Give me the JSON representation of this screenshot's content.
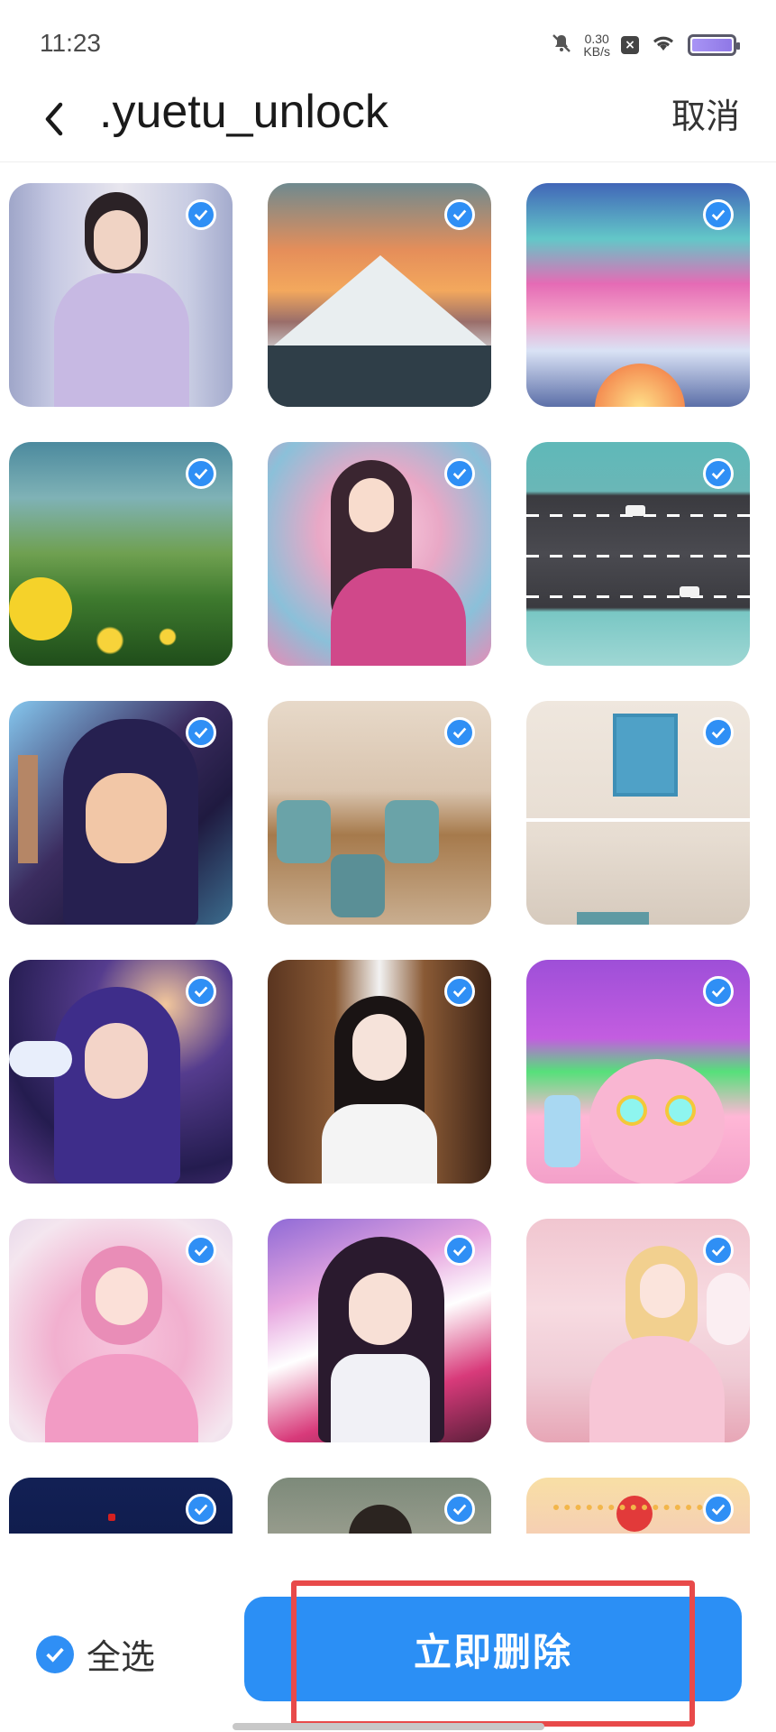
{
  "status_bar": {
    "time": "11:23",
    "net_speed_value": "0.30",
    "net_speed_unit": "KB/s",
    "icons": [
      "mute-icon",
      "close-box-icon",
      "wifi-icon",
      "battery-icon"
    ]
  },
  "header": {
    "back_icon": "chevron-left-icon",
    "title": ".yuetu_unlock",
    "cancel_label": "取消"
  },
  "grid": {
    "tiles": [
      {
        "scene": "woman-lavender-dress",
        "selected": true
      },
      {
        "scene": "snowy-mountain-sunset",
        "selected": true
      },
      {
        "scene": "aurora-over-mountains",
        "selected": true
      },
      {
        "scene": "alpine-meadow-flowers",
        "selected": true
      },
      {
        "scene": "anime-fairy-pink-dress",
        "selected": true
      },
      {
        "scene": "aerial-highway",
        "selected": true
      },
      {
        "scene": "anime-cat-ear-girl-castle",
        "selected": true
      },
      {
        "scene": "kids-room-shelves",
        "selected": true
      },
      {
        "scene": "beige-living-room",
        "selected": true
      },
      {
        "scene": "anime-girl-moon-night",
        "selected": true
      },
      {
        "scene": "girl-school-uniform",
        "selected": true
      },
      {
        "scene": "cartoon-graffiti-character",
        "selected": true
      },
      {
        "scene": "anime-pink-princess",
        "selected": true
      },
      {
        "scene": "anime-girl-rainbow",
        "selected": true
      },
      {
        "scene": "woman-pink-bedroom",
        "selected": true
      },
      {
        "scene": "dark-blue-night",
        "selected": true
      },
      {
        "scene": "garden-portrait",
        "selected": true
      },
      {
        "scene": "golden-pink-ornament",
        "selected": true
      }
    ]
  },
  "bottom": {
    "select_all_label": "全选",
    "select_all_checked": true,
    "delete_label": "立即删除"
  },
  "colors": {
    "accent": "#2b8ff5",
    "highlight_border": "#e84a4a"
  }
}
